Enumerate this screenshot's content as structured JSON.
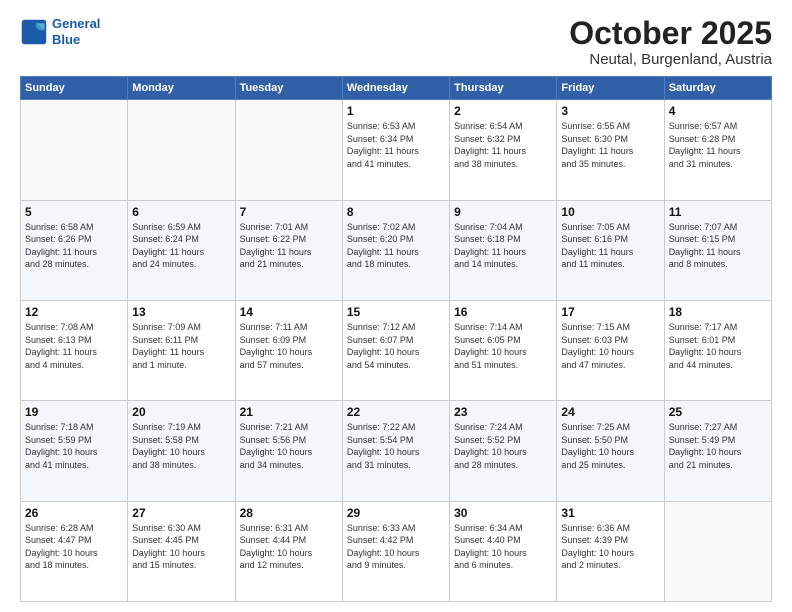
{
  "logo": {
    "line1": "General",
    "line2": "Blue"
  },
  "header": {
    "month": "October 2025",
    "location": "Neutal, Burgenland, Austria"
  },
  "days_of_week": [
    "Sunday",
    "Monday",
    "Tuesday",
    "Wednesday",
    "Thursday",
    "Friday",
    "Saturday"
  ],
  "weeks": [
    [
      {
        "day": "",
        "info": ""
      },
      {
        "day": "",
        "info": ""
      },
      {
        "day": "",
        "info": ""
      },
      {
        "day": "1",
        "info": "Sunrise: 6:53 AM\nSunset: 6:34 PM\nDaylight: 11 hours\nand 41 minutes."
      },
      {
        "day": "2",
        "info": "Sunrise: 6:54 AM\nSunset: 6:32 PM\nDaylight: 11 hours\nand 38 minutes."
      },
      {
        "day": "3",
        "info": "Sunrise: 6:55 AM\nSunset: 6:30 PM\nDaylight: 11 hours\nand 35 minutes."
      },
      {
        "day": "4",
        "info": "Sunrise: 6:57 AM\nSunset: 6:28 PM\nDaylight: 11 hours\nand 31 minutes."
      }
    ],
    [
      {
        "day": "5",
        "info": "Sunrise: 6:58 AM\nSunset: 6:26 PM\nDaylight: 11 hours\nand 28 minutes."
      },
      {
        "day": "6",
        "info": "Sunrise: 6:59 AM\nSunset: 6:24 PM\nDaylight: 11 hours\nand 24 minutes."
      },
      {
        "day": "7",
        "info": "Sunrise: 7:01 AM\nSunset: 6:22 PM\nDaylight: 11 hours\nand 21 minutes."
      },
      {
        "day": "8",
        "info": "Sunrise: 7:02 AM\nSunset: 6:20 PM\nDaylight: 11 hours\nand 18 minutes."
      },
      {
        "day": "9",
        "info": "Sunrise: 7:04 AM\nSunset: 6:18 PM\nDaylight: 11 hours\nand 14 minutes."
      },
      {
        "day": "10",
        "info": "Sunrise: 7:05 AM\nSunset: 6:16 PM\nDaylight: 11 hours\nand 11 minutes."
      },
      {
        "day": "11",
        "info": "Sunrise: 7:07 AM\nSunset: 6:15 PM\nDaylight: 11 hours\nand 8 minutes."
      }
    ],
    [
      {
        "day": "12",
        "info": "Sunrise: 7:08 AM\nSunset: 6:13 PM\nDaylight: 11 hours\nand 4 minutes."
      },
      {
        "day": "13",
        "info": "Sunrise: 7:09 AM\nSunset: 6:11 PM\nDaylight: 11 hours\nand 1 minute."
      },
      {
        "day": "14",
        "info": "Sunrise: 7:11 AM\nSunset: 6:09 PM\nDaylight: 10 hours\nand 57 minutes."
      },
      {
        "day": "15",
        "info": "Sunrise: 7:12 AM\nSunset: 6:07 PM\nDaylight: 10 hours\nand 54 minutes."
      },
      {
        "day": "16",
        "info": "Sunrise: 7:14 AM\nSunset: 6:05 PM\nDaylight: 10 hours\nand 51 minutes."
      },
      {
        "day": "17",
        "info": "Sunrise: 7:15 AM\nSunset: 6:03 PM\nDaylight: 10 hours\nand 47 minutes."
      },
      {
        "day": "18",
        "info": "Sunrise: 7:17 AM\nSunset: 6:01 PM\nDaylight: 10 hours\nand 44 minutes."
      }
    ],
    [
      {
        "day": "19",
        "info": "Sunrise: 7:18 AM\nSunset: 5:59 PM\nDaylight: 10 hours\nand 41 minutes."
      },
      {
        "day": "20",
        "info": "Sunrise: 7:19 AM\nSunset: 5:58 PM\nDaylight: 10 hours\nand 38 minutes."
      },
      {
        "day": "21",
        "info": "Sunrise: 7:21 AM\nSunset: 5:56 PM\nDaylight: 10 hours\nand 34 minutes."
      },
      {
        "day": "22",
        "info": "Sunrise: 7:22 AM\nSunset: 5:54 PM\nDaylight: 10 hours\nand 31 minutes."
      },
      {
        "day": "23",
        "info": "Sunrise: 7:24 AM\nSunset: 5:52 PM\nDaylight: 10 hours\nand 28 minutes."
      },
      {
        "day": "24",
        "info": "Sunrise: 7:25 AM\nSunset: 5:50 PM\nDaylight: 10 hours\nand 25 minutes."
      },
      {
        "day": "25",
        "info": "Sunrise: 7:27 AM\nSunset: 5:49 PM\nDaylight: 10 hours\nand 21 minutes."
      }
    ],
    [
      {
        "day": "26",
        "info": "Sunrise: 6:28 AM\nSunset: 4:47 PM\nDaylight: 10 hours\nand 18 minutes."
      },
      {
        "day": "27",
        "info": "Sunrise: 6:30 AM\nSunset: 4:45 PM\nDaylight: 10 hours\nand 15 minutes."
      },
      {
        "day": "28",
        "info": "Sunrise: 6:31 AM\nSunset: 4:44 PM\nDaylight: 10 hours\nand 12 minutes."
      },
      {
        "day": "29",
        "info": "Sunrise: 6:33 AM\nSunset: 4:42 PM\nDaylight: 10 hours\nand 9 minutes."
      },
      {
        "day": "30",
        "info": "Sunrise: 6:34 AM\nSunset: 4:40 PM\nDaylight: 10 hours\nand 6 minutes."
      },
      {
        "day": "31",
        "info": "Sunrise: 6:36 AM\nSunset: 4:39 PM\nDaylight: 10 hours\nand 2 minutes."
      },
      {
        "day": "",
        "info": ""
      }
    ]
  ]
}
